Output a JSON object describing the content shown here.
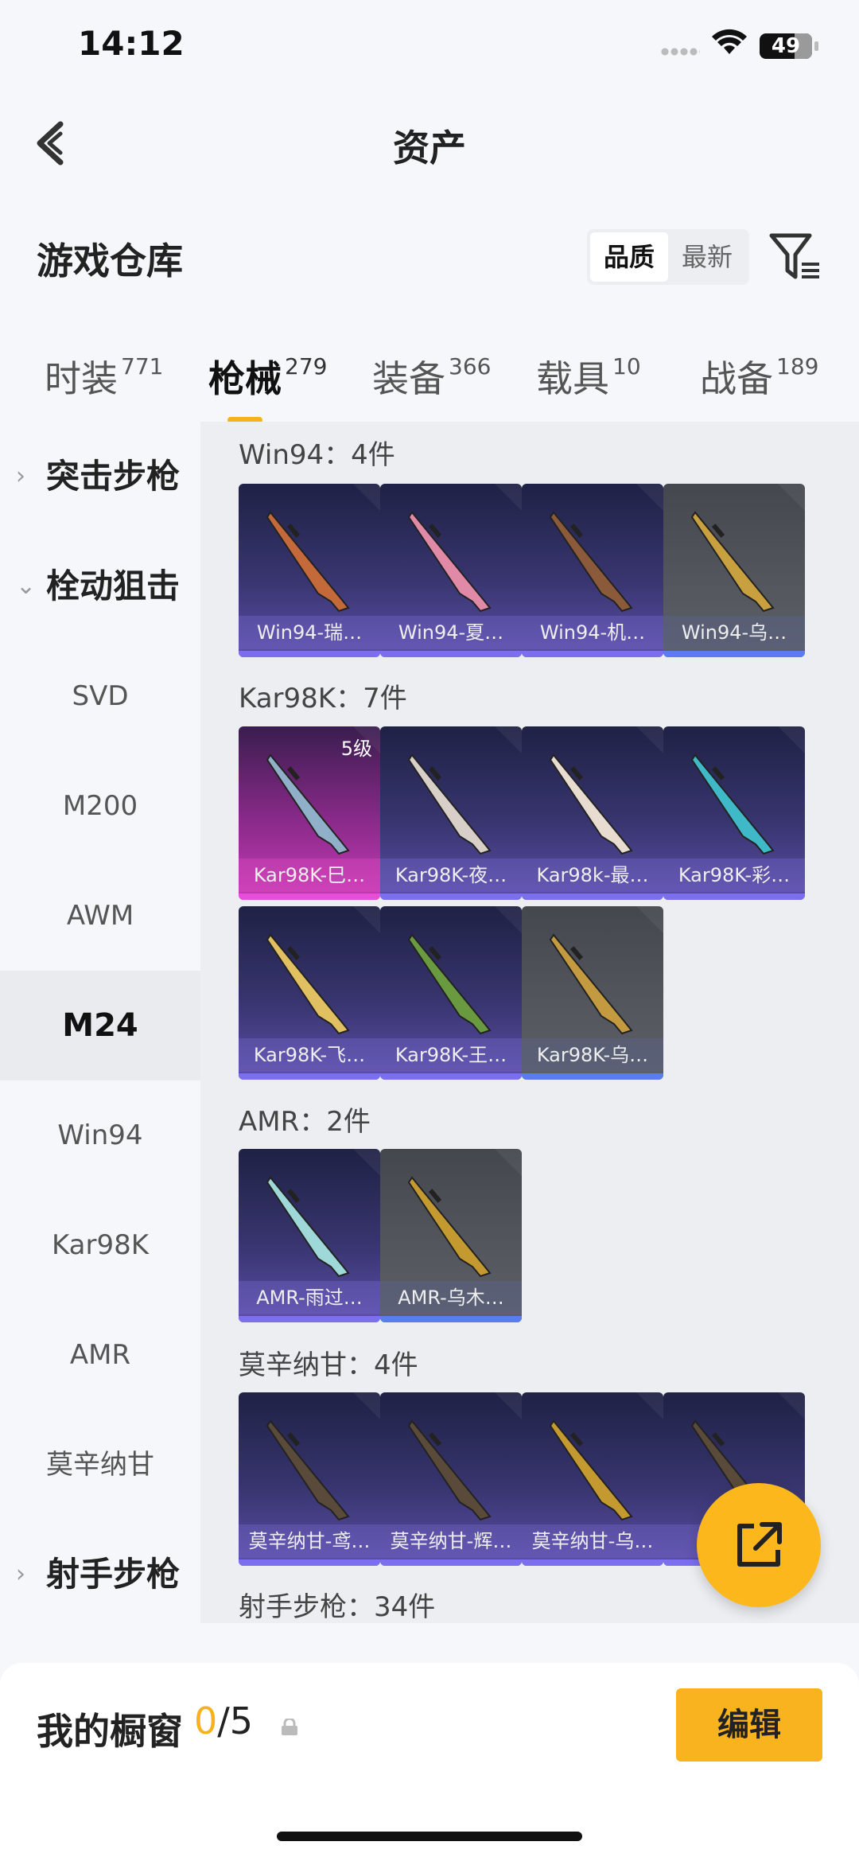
{
  "status": {
    "time": "14:12",
    "battery": "49"
  },
  "nav": {
    "title": "资产"
  },
  "header": {
    "title": "游戏仓库",
    "sort": [
      "品质",
      "最新"
    ]
  },
  "tabs": [
    {
      "label": "时装",
      "count": "771"
    },
    {
      "label": "枪械",
      "count": "279"
    },
    {
      "label": "装备",
      "count": "366"
    },
    {
      "label": "载具",
      "count": "10"
    },
    {
      "label": "战备",
      "count": "189"
    }
  ],
  "categories": [
    {
      "label": "突击步枪",
      "chevron": "›"
    },
    {
      "label": "栓动狙击",
      "chevron": "⌄"
    },
    {
      "label": "SVD"
    },
    {
      "label": "M200"
    },
    {
      "label": "AWM"
    },
    {
      "label": "M24"
    },
    {
      "label": "Win94"
    },
    {
      "label": "Kar98K"
    },
    {
      "label": "AMR"
    },
    {
      "label": "莫辛纳甘"
    },
    {
      "label": "射手步枪",
      "chevron": "›"
    }
  ],
  "groups": [
    {
      "label": "Win94：4件",
      "items": [
        "Win94-瑞…",
        "Win94-夏…",
        "Win94-机…",
        "Win94-乌…"
      ]
    },
    {
      "label": "Kar98K：7件",
      "items": [
        "Kar98K-巳…",
        "Kar98K-夜…",
        "Kar98k-最…",
        "Kar98K-彩…",
        "Kar98K-飞…",
        "Kar98K-王…",
        "Kar98K-乌…"
      ],
      "badge": "5级"
    },
    {
      "label": "AMR：2件",
      "items": [
        "AMR-雨过…",
        "AMR-乌木…"
      ]
    },
    {
      "label": "莫辛纳甘：4件",
      "items": [
        "莫辛纳甘-鸢…",
        "莫辛纳甘-辉…",
        "莫辛纳甘-乌…",
        "莫"
      ]
    },
    {
      "label": "射手步枪：34件"
    }
  ],
  "showcase": {
    "label": "我的橱窗",
    "current": "0",
    "total": "/5",
    "edit": "编辑"
  },
  "icons": {
    "back": "chevron-left-icon",
    "filter": "filter-icon",
    "share": "share-external-icon",
    "lock": "lock-icon"
  },
  "colors": {
    "accent": "#f5b21e",
    "card_purple": "#38356f",
    "card_grey": "#55575f",
    "card_pink": "#c73bb5"
  }
}
